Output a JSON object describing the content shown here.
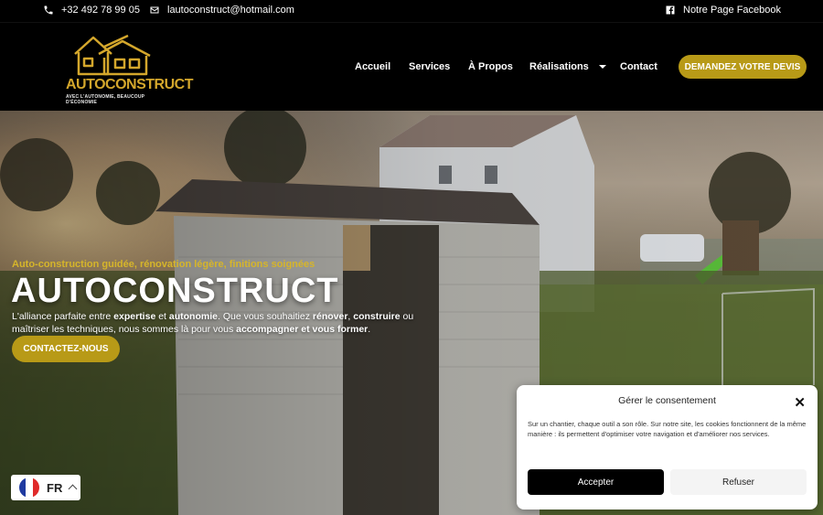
{
  "topbar": {
    "phone": "+32 492 78 99 05",
    "email": "lautoconstruct@hotmail.com",
    "facebook": "Notre Page Facebook"
  },
  "logo": {
    "name": "AUTOCONSTRUCT",
    "slogan": "AVEC L'AUTONOMIE, BEAUCOUP D'ÉCONOMIE"
  },
  "nav": {
    "items": [
      "Accueil",
      "Services",
      "À Propos",
      "Réalisations",
      "Contact"
    ],
    "cta": "DEMANDEZ VOTRE DEVIS"
  },
  "hero": {
    "tagline": "Auto-construction guidée, rénovation légère, finitions soignées",
    "title": "AUTOCONSTRUCT",
    "text": {
      "p1": "L'alliance parfaite entre ",
      "b1": "expertise",
      "p2": " et ",
      "b2": "autonomie",
      "p3": ". Que vous souhaitiez ",
      "b3": "rénover",
      "p4": ", ",
      "b4": "construire",
      "p5": " ou maîtriser les techniques, nous sommes là pour vous ",
      "b5": "accompagner et vous former",
      "p6": "."
    },
    "button": "CONTACTEZ-NOUS"
  },
  "language": {
    "code": "FR"
  },
  "cookie": {
    "title": "Gérer le consentement",
    "close": "✕",
    "text": "Sur un chantier, chaque outil a son rôle. Sur notre site, les cookies fonctionnent de la même manière : ils permettent d'optimiser votre navigation et d'améliorer nos services.",
    "accept": "Accepter",
    "refuse": "Refuser"
  },
  "colors": {
    "accent": "#b89a17",
    "logo_gold": "#d4a72c",
    "background": "#000000"
  }
}
